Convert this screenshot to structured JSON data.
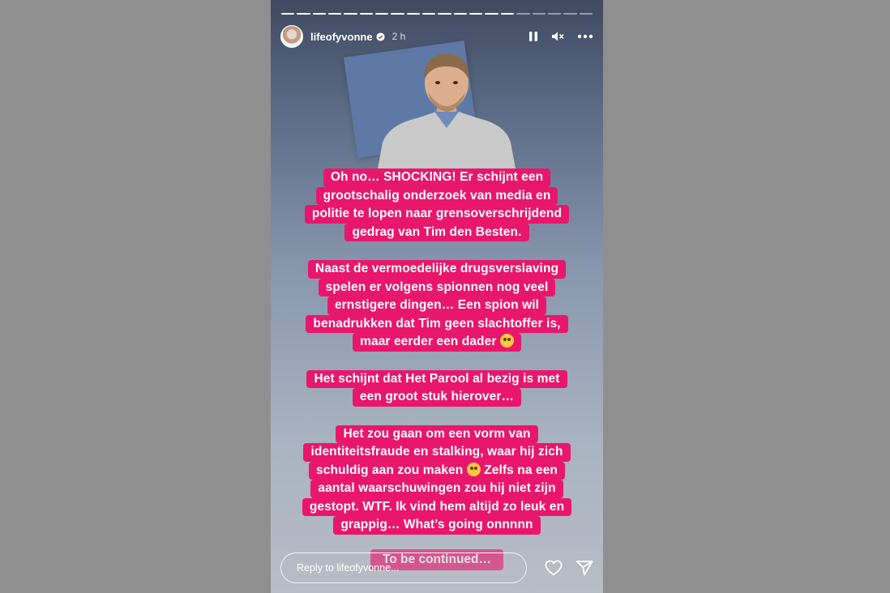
{
  "story": {
    "username": "lifeofyvonne",
    "time": "2 h",
    "progress": {
      "segments": 20,
      "current": 15
    }
  },
  "text_blocks": [
    {
      "lines": [
        "Oh no… SHOCKING! Er schijnt een",
        "grootschalig onderzoek van media en",
        "politie te lopen naar grensoverschrijdend",
        "gedrag van Tim den Besten."
      ]
    },
    {
      "lines": [
        "Naast de vermoedelijke drugsverslaving",
        "spelen er volgens spionnen nog veel",
        "ernstigere dingen… Een spion wil",
        "benadrukken dat Tim geen slachtoffer is,",
        "maar eerder een dader"
      ]
    },
    {
      "lines": [
        "Het schijnt dat Het Parool al bezig is met",
        "een groot stuk hierover…"
      ]
    },
    {
      "lines": [
        "Het zou gaan om een vorm van",
        "identiteitsfraude en stalking, waar hij zich",
        "schuldig aan zou maken",
        "aantal waarschuwingen zou hij niet zijn",
        "gestopt. WTF. Ik vind hem altijd zo leuk en",
        "grappig… What’s going onnnnn"
      ]
    }
  ],
  "line3_suffix": "Zelfs na een",
  "continued": "To be continued…",
  "reply": {
    "placeholder": "Reply to lifeofyvonne..."
  },
  "icons": {
    "avatar": "avatar",
    "verified": "verified-badge-icon",
    "pause": "pause-icon",
    "mute": "mute-icon",
    "more": "more-icon",
    "like": "heart-icon",
    "share": "send-icon",
    "emoji": "flushed-face-emoji"
  },
  "colors": {
    "highlight": "#e8176c",
    "page_bg": "#8f8f8f"
  }
}
